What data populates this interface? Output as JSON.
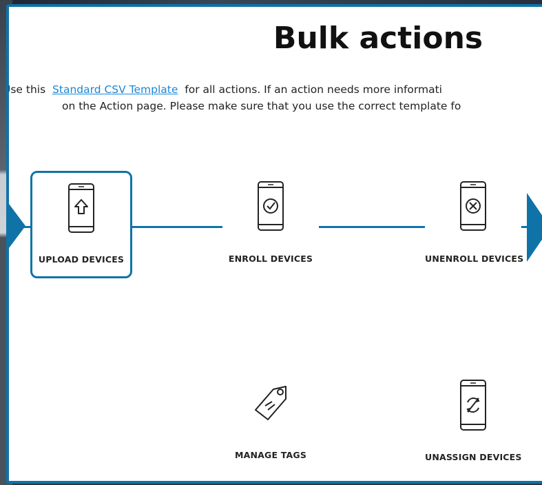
{
  "modal": {
    "title": "Bulk actions",
    "desc_prefix": "Use this",
    "link_text": "Standard CSV Template",
    "desc_suffix": "for all actions. If an action needs more informati",
    "desc_line2": "on the Action page. Please make sure that you use the correct template fo"
  },
  "actions": [
    {
      "label": "UPLOAD DEVICES",
      "icon": "phone-upload-icon",
      "selected": true
    },
    {
      "label": "ENROLL DEVICES",
      "icon": "phone-check-icon",
      "selected": false
    },
    {
      "label": "UNENROLL DEVICES",
      "icon": "phone-x-icon",
      "selected": false
    },
    {
      "label": "MANAGE TAGS",
      "icon": "tag-icon",
      "selected": false
    },
    {
      "label": "UNASSIGN DEVICES",
      "icon": "phone-unassign-icon",
      "selected": false
    }
  ],
  "colors": {
    "accent": "#0f73a8",
    "link": "#1a87d6"
  }
}
